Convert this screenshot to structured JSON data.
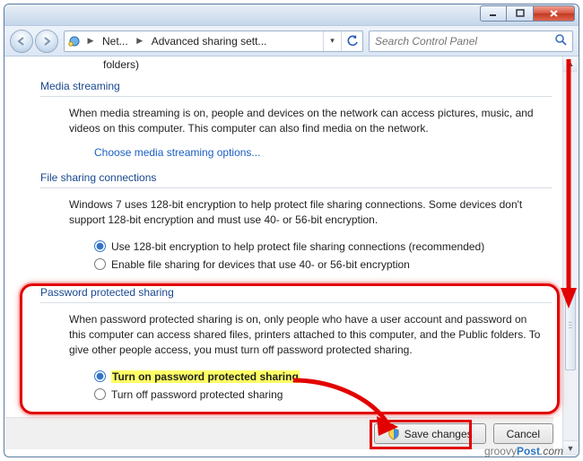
{
  "breadcrumb": {
    "seg1": "Net...",
    "seg2": "Advanced sharing sett..."
  },
  "search": {
    "placeholder": "Search Control Panel"
  },
  "top_fragment": "folders)",
  "media": {
    "heading": "Media streaming",
    "para": "When media streaming is on, people and devices on the network can access pictures, music, and videos on this computer. This computer can also find media on the network.",
    "link": "Choose media streaming options..."
  },
  "fileconn": {
    "heading": "File sharing connections",
    "para": "Windows 7 uses 128-bit encryption to help protect file sharing connections. Some devices don't support 128-bit encryption and must use 40- or 56-bit encryption.",
    "opt1": "Use 128-bit encryption to help protect file sharing connections (recommended)",
    "opt2": "Enable file sharing for devices that use 40- or 56-bit encryption"
  },
  "pps": {
    "heading": "Password protected sharing",
    "para": "When password protected sharing is on, only people who have a user account and password on this computer can access shared files, printers attached to this computer, and the Public folders. To give other people access, you must turn off password protected sharing.",
    "opt1": "Turn on password protected sharing",
    "opt2": "Turn off password protected sharing"
  },
  "buttons": {
    "save": "Save changes",
    "cancel": "Cancel"
  },
  "watermark": {
    "brand1": "groovy",
    "brand2": "Post",
    "suffix": ".com"
  }
}
